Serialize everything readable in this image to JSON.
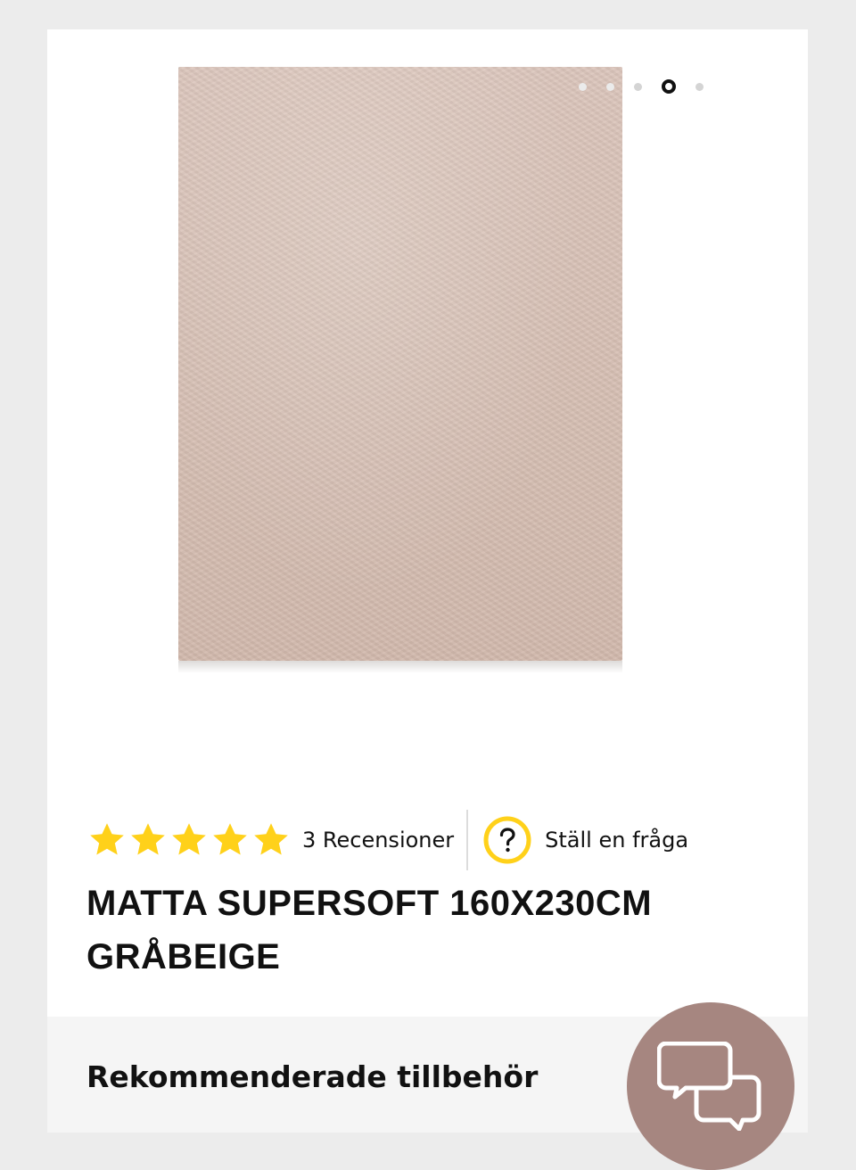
{
  "carousel": {
    "slide_count": 5,
    "active_index": 3
  },
  "rating": {
    "stars": 5,
    "star_color": "#FFD11A",
    "reviews_label": "3 Recensioner"
  },
  "question": {
    "label": "Ställ en fråga",
    "icon": "question-circle-icon",
    "icon_color": "#FFD11A"
  },
  "product": {
    "title": "MATTA SUPERSOFT 160X230CM GRÅBEIGE"
  },
  "accessories": {
    "title": "Rekommenderade tillbehör"
  },
  "chat": {
    "icon": "chat-bubbles-icon",
    "color": "#A68680"
  }
}
